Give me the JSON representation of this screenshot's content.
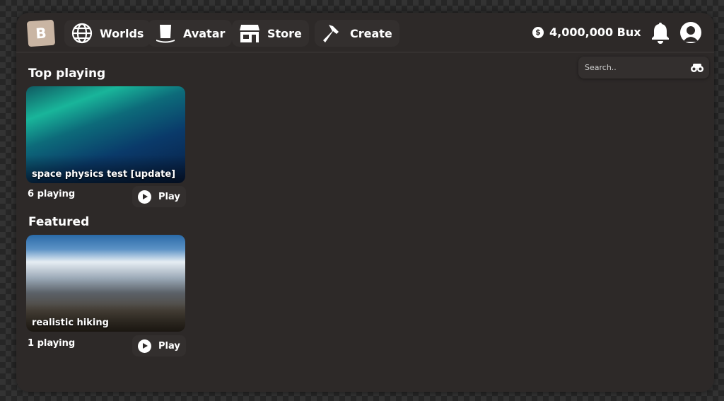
{
  "nav": {
    "logo": "B",
    "items": [
      {
        "label": "Worlds",
        "icon": "globe-icon"
      },
      {
        "label": "Avatar",
        "icon": "top-hat-icon"
      },
      {
        "label": "Store",
        "icon": "store-icon"
      },
      {
        "label": "Create",
        "icon": "hammer-icon"
      }
    ]
  },
  "currency": {
    "symbol": "$",
    "amount": "4,000,000 Bux"
  },
  "search": {
    "placeholder": "Search.."
  },
  "sections": [
    {
      "heading": "Top playing",
      "game": {
        "title": "space physics test [update]",
        "players": "6 playing",
        "play": "Play"
      }
    },
    {
      "heading": "Featured",
      "game": {
        "title": "realistic hiking",
        "players": "1 playing",
        "play": "Play"
      }
    }
  ]
}
